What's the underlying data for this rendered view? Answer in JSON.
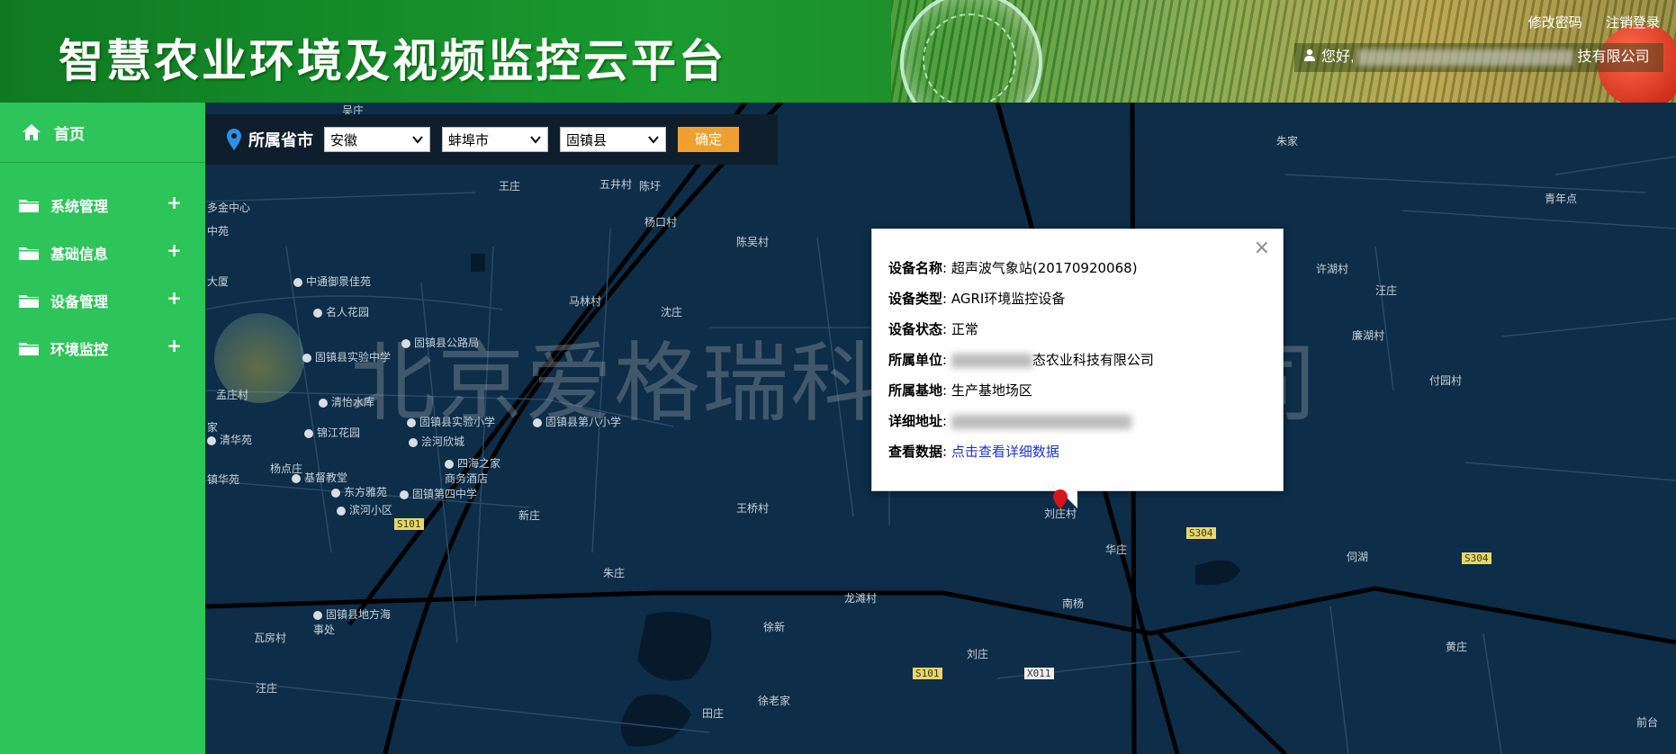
{
  "header": {
    "app_title": "智慧农业环境及视频监控云平台",
    "change_password": "修改密码",
    "logout": "注销登录",
    "greeting": "您好,",
    "company_suffix": "技有限公司"
  },
  "sidebar": {
    "home": "首页",
    "items": [
      {
        "label": "系统管理",
        "expand": "+"
      },
      {
        "label": "基础信息",
        "expand": "+"
      },
      {
        "label": "设备管理",
        "expand": "+"
      },
      {
        "label": "环境监控",
        "expand": "+"
      }
    ]
  },
  "filter": {
    "label": "所属省市",
    "province": "安徽",
    "city": "蚌埠市",
    "county": "固镇县",
    "confirm": "确定"
  },
  "popup": {
    "device_name_label": "设备名称",
    "device_name": "超声波气象站(20170920068)",
    "device_type_label": "设备类型",
    "device_type": "AGRI环境监控设备",
    "device_status_label": "设备状态",
    "device_status": "正常",
    "unit_label": "所属单位",
    "unit_suffix": "态农业科技有限公司",
    "base_label": "所属基地",
    "base": "生产基地场区",
    "address_label": "详细地址",
    "data_label": "查看数据",
    "data_link": "点击查看详细数据",
    "close": "×",
    "colon": ":"
  },
  "map": {
    "watermark": "北京爱格瑞科技有限公司",
    "places": [
      "吴庄",
      "王庄",
      "五井村",
      "陈圩",
      "杨口村",
      "陈吴村",
      "多金中心",
      "中苑",
      "大厦",
      "马林村",
      "沈庄",
      "朱家",
      "青年点",
      "孟庄村",
      "家",
      "杨点庄",
      "镇华苑",
      "新庄",
      "王桥村",
      "刘庄村",
      "华庄",
      "伺湖",
      "南杨",
      "朱庄",
      "龙滩村",
      "徐新",
      "刘庄",
      "瓦房村",
      "汪庄",
      "田庄",
      "徐老家",
      "黄庄",
      "前台",
      "汪庄",
      "廉湖村",
      "许湖村",
      "付园村"
    ],
    "pois": [
      "中通御景佳苑",
      "名人花园",
      "固镇县公路局",
      "固镇县实验中学",
      "清怡水库",
      "锦江花园",
      "固镇县实验小学",
      "固镇县第八小学",
      "浍河欣城",
      "四海之家商务酒店",
      "基督教堂",
      "东方雅苑",
      "固镇第四中学",
      "滨河小区",
      "固镇县地方海事处",
      "清华苑"
    ],
    "shields": [
      "S101",
      "S304",
      "S304",
      "S101",
      "X011"
    ]
  },
  "colors": {
    "header_green": "#1a9a2f",
    "sidebar_green": "#2dc45a",
    "map_bg": "#0d2d48",
    "confirm_orange": "#f0a030",
    "link_blue": "#1a33d6"
  }
}
